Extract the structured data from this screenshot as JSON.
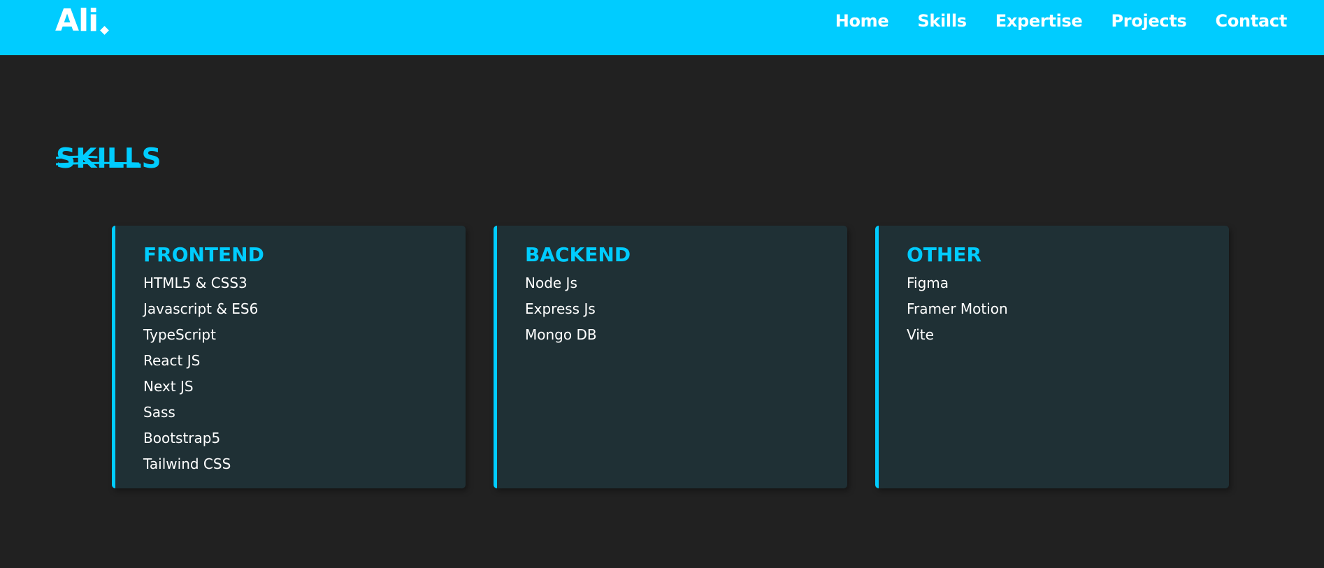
{
  "nav": {
    "logo": "Ali",
    "links": [
      "Home",
      "Skills",
      "Expertise",
      "Projects",
      "Contact"
    ]
  },
  "section": {
    "title": "SKILLS"
  },
  "cards": [
    {
      "title": "FRONTEND",
      "items": [
        "HTML5 & CSS3",
        "Javascript & ES6",
        "TypeScript",
        "React JS",
        "Next JS",
        "Sass",
        "Bootstrap5",
        "Tailwind CSS"
      ]
    },
    {
      "title": "BACKEND",
      "items": [
        "Node Js",
        "Express Js",
        "Mongo DB"
      ]
    },
    {
      "title": "OTHER",
      "items": [
        "Figma",
        "Framer Motion",
        "Vite"
      ]
    }
  ],
  "colors": {
    "accent": "#00ccff",
    "background": "#212121",
    "card": "#1f3035",
    "text": "#ffffff"
  }
}
